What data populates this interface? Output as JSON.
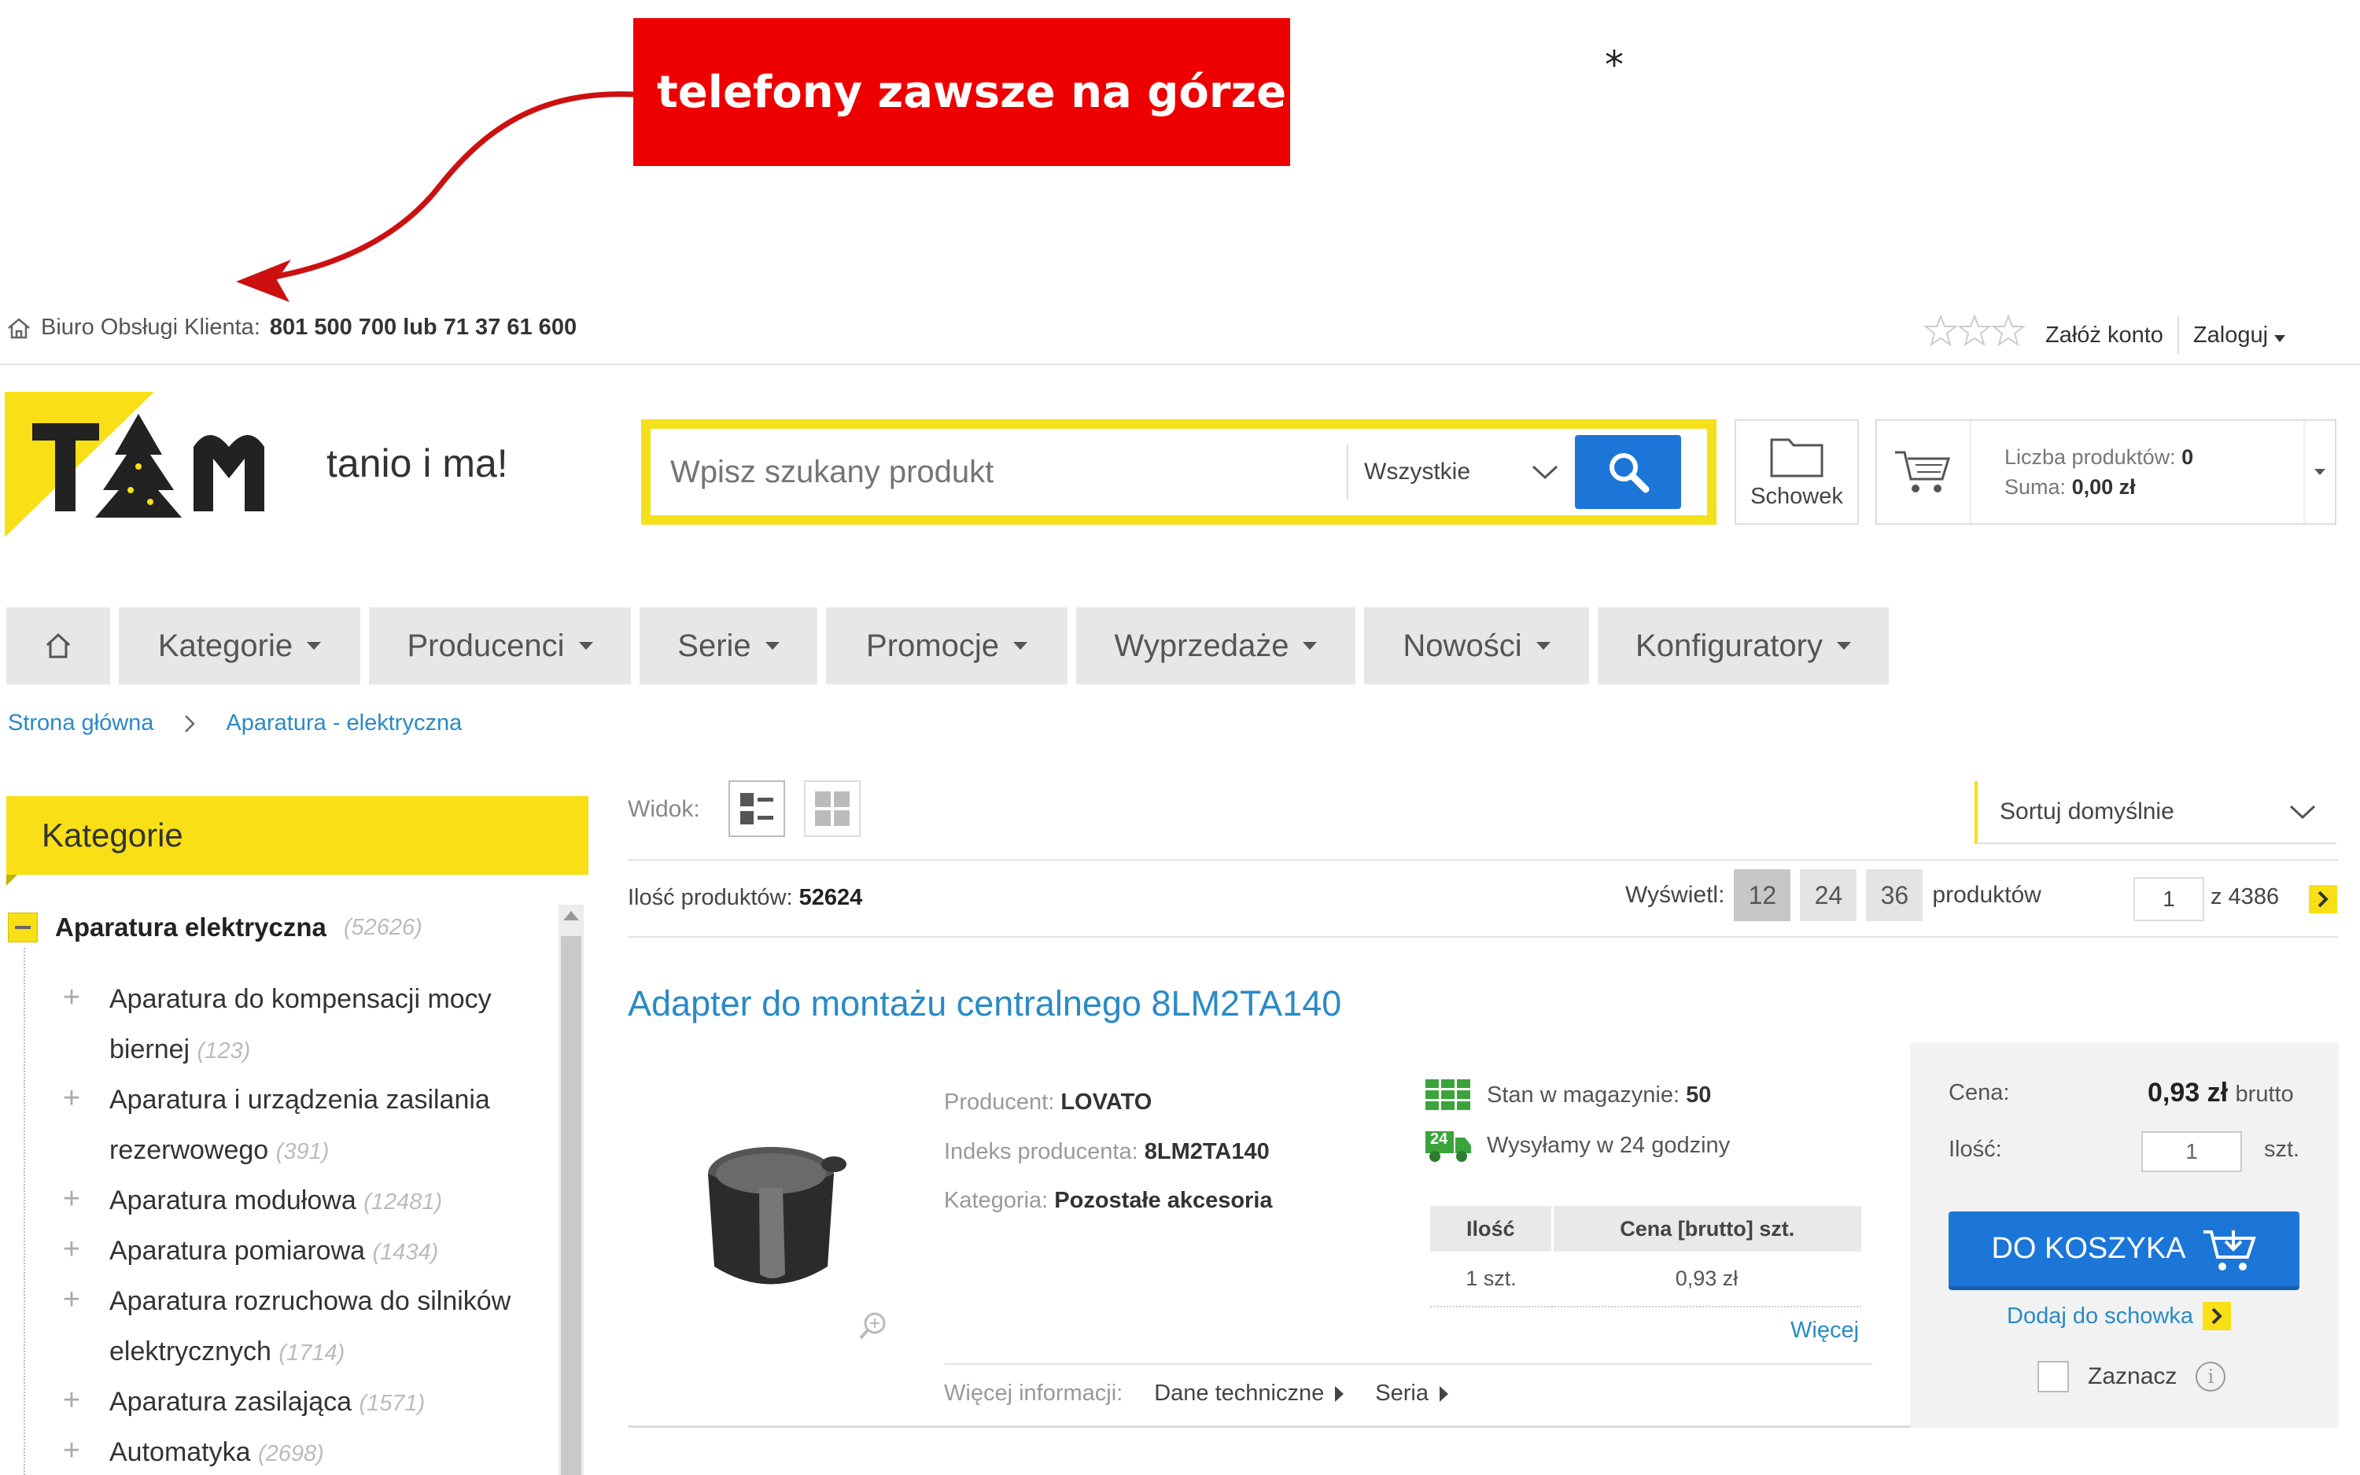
{
  "annotation": {
    "callout": "telefony zawsze na górze",
    "asterisk": "*"
  },
  "topbar": {
    "service_label": "Biuro Obsługi Klienta:",
    "phones": "801 500 700 lub 71 37 61 600",
    "register": "Załóż konto",
    "login": "Zaloguj"
  },
  "header": {
    "slogan": "tanio i ma!",
    "search_placeholder": "Wpisz szukany produkt",
    "search_scope": "Wszystkie",
    "stash_label": "Schowek",
    "cart_count_label": "Liczba produktów:",
    "cart_count": "0",
    "cart_sum_label": "Suma:",
    "cart_sum": "0,00 zł"
  },
  "nav": {
    "items": [
      "Kategorie",
      "Producenci",
      "Serie",
      "Promocje",
      "Wyprzedaże",
      "Nowości",
      "Konfiguratory"
    ]
  },
  "breadcrumb": {
    "home": "Strona główna",
    "current": "Aparatura - elektryczna"
  },
  "sidebar": {
    "title": "Kategorie",
    "root": {
      "label": "Aparatura elektryczna",
      "count": "(52626)"
    },
    "items": [
      {
        "label": "Aparatura do kompensacji mocy biernej",
        "count": "(123)"
      },
      {
        "label": "Aparatura i urządzenia zasilania rezerwowego",
        "count": "(391)"
      },
      {
        "label": "Aparatura modułowa",
        "count": "(12481)"
      },
      {
        "label": "Aparatura pomiarowa",
        "count": "(1434)"
      },
      {
        "label": "Aparatura rozruchowa do silników elektrycznych",
        "count": "(1714)"
      },
      {
        "label": "Aparatura zasilająca",
        "count": "(1571)"
      },
      {
        "label": "Automatyka",
        "count": "(2698)"
      }
    ]
  },
  "toolbar": {
    "view_label": "Widok:",
    "sort": "Sortuj domyślnie",
    "count_label": "Ilość produktów:",
    "count": "52624",
    "show_label": "Wyświetl:",
    "per_page": [
      "12",
      "24",
      "36"
    ],
    "per_page_suffix": "produktów",
    "page": "1",
    "page_total": "z 4386"
  },
  "product": {
    "title": "Adapter do montażu centralnego 8LM2TA140",
    "producer_label": "Producent:",
    "producer": "LOVATO",
    "index_label": "Indeks producenta:",
    "index": "8LM2TA140",
    "category_label": "Kategoria:",
    "category": "Pozostałe akcesoria",
    "stock_label": "Stan w magazynie:",
    "stock": "50",
    "shipping": "Wysyłamy w 24 godziny",
    "shipping_badge": "24",
    "table_headers": [
      "Ilość",
      "Cena [brutto] szt."
    ],
    "table_rows": [
      [
        "1 szt.",
        "0,93 zł"
      ]
    ],
    "more_link": "Więcej",
    "more_info_label": "Więcej informacji:",
    "tech_data": "Dane techniczne",
    "series": "Seria",
    "price_label": "Cena:",
    "price": "0,93 zł",
    "price_suffix": "brutto",
    "qty_label": "Ilość:",
    "qty": "1",
    "qty_unit": "szt.",
    "buy_button": "DO KOSZYKA",
    "add_to_stash": "Dodaj do schowka",
    "mark_label": "Zaznacz"
  },
  "colors": {
    "brand_yellow": "#f8df16",
    "link_blue": "#2a8ac6",
    "button_blue": "#1b76d8",
    "callout_red": "#ee0000"
  }
}
